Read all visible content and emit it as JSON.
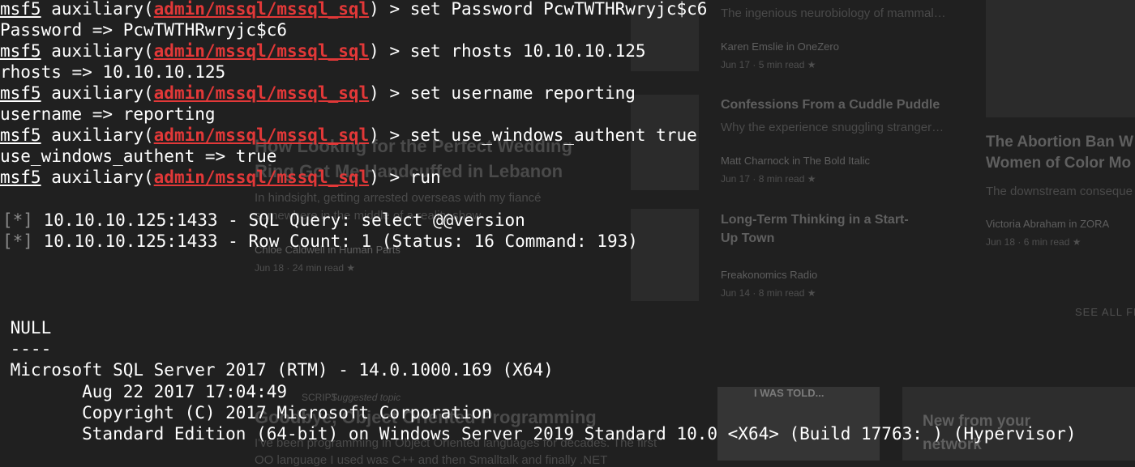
{
  "background": {
    "items": [
      {
        "sub": "The ingenious neurobiology of mammal…",
        "author": "Karen Emslie in OneZero",
        "meta": "Jun 17 · 5 min read ★"
      },
      {
        "title": "Confessions From a Cuddle Puddle",
        "sub": "Why the experience snuggling stranger…",
        "author": "Matt Charnock in The Bold Italic",
        "meta": "Jun 17 · 8 min read ★"
      },
      {
        "title_line1": "Long-Term Thinking in a Start-",
        "title_line2": "Up Town",
        "author": "Freakonomics Radio",
        "meta": "Jun 14 · 8 min read ★"
      }
    ],
    "left_article": {
      "title_line1": "How Looking for the Perfect Wedding",
      "title_line2": "Ring Got Me Handcuffed in Lebanon",
      "sub_line1": "In hindsight, getting arrested overseas with my fiancé",
      "sub_line2": "somewhere in the middle of a reality show",
      "author": "Chloe Caldwell in Human Parts",
      "meta": "Jun 18 · 24 min read ★"
    },
    "right_article": {
      "title_line1": "The Abortion Ban W",
      "title_line2": "Women of Color Mo",
      "sub": "The downstream conseque",
      "author": "Victoria Abraham in ZORA",
      "meta": "Jun 18 · 6 min read ★"
    },
    "see_all": "SEE ALL FE",
    "bottom": {
      "tag": "SCRIPT",
      "suggested": "Suggested topic",
      "title": "Goodbye, Object Oriented Programming",
      "sub_line1": "I've been programming in Object Oriented languages for decades. The first",
      "sub_line2": "OO language I used was C++ and then Smalltalk and finally .NET",
      "image_caption": "I WAS TOLD...",
      "promo_line1": "New from your",
      "promo_line2": "network"
    }
  },
  "terminal": {
    "prompt": "msf5",
    "module_prefix": " auxiliary(",
    "module": "admin/mssql/mssql_sql",
    "module_suffix": ") > ",
    "star": "[*]",
    "commands": [
      {
        "cmd": "set Password PcwTWTHRwryjc$c6",
        "out": "Password => PcwTWTHRwryjc$c6"
      },
      {
        "cmd": "set rhosts 10.10.10.125",
        "out": "rhosts => 10.10.10.125"
      },
      {
        "cmd": "set username reporting",
        "out": "username => reporting"
      },
      {
        "cmd": "set use_windows_authent true",
        "out": "use_windows_authent => true"
      },
      {
        "cmd": "run"
      }
    ],
    "status_lines": [
      " 10.10.10.125:1433 - SQL Query: select @@version",
      " 10.10.10.125:1433 - Row Count: 1 (Status: 16 Command: 193)"
    ],
    "result": [
      " NULL",
      " ----",
      " Microsoft SQL Server 2017 (RTM) - 14.0.1000.169 (X64)",
      "        Aug 22 2017 17:04:49",
      "        Copyright (C) 2017 Microsoft Corporation",
      "        Standard Edition (64-bit) on Windows Server 2019 Standard 10.0 <X64> (Build 17763: ) (Hypervisor)"
    ]
  },
  "colors": {
    "background": "#202020",
    "text": "#ffffff",
    "module": "#e23838",
    "star": "#8a8a8a"
  }
}
